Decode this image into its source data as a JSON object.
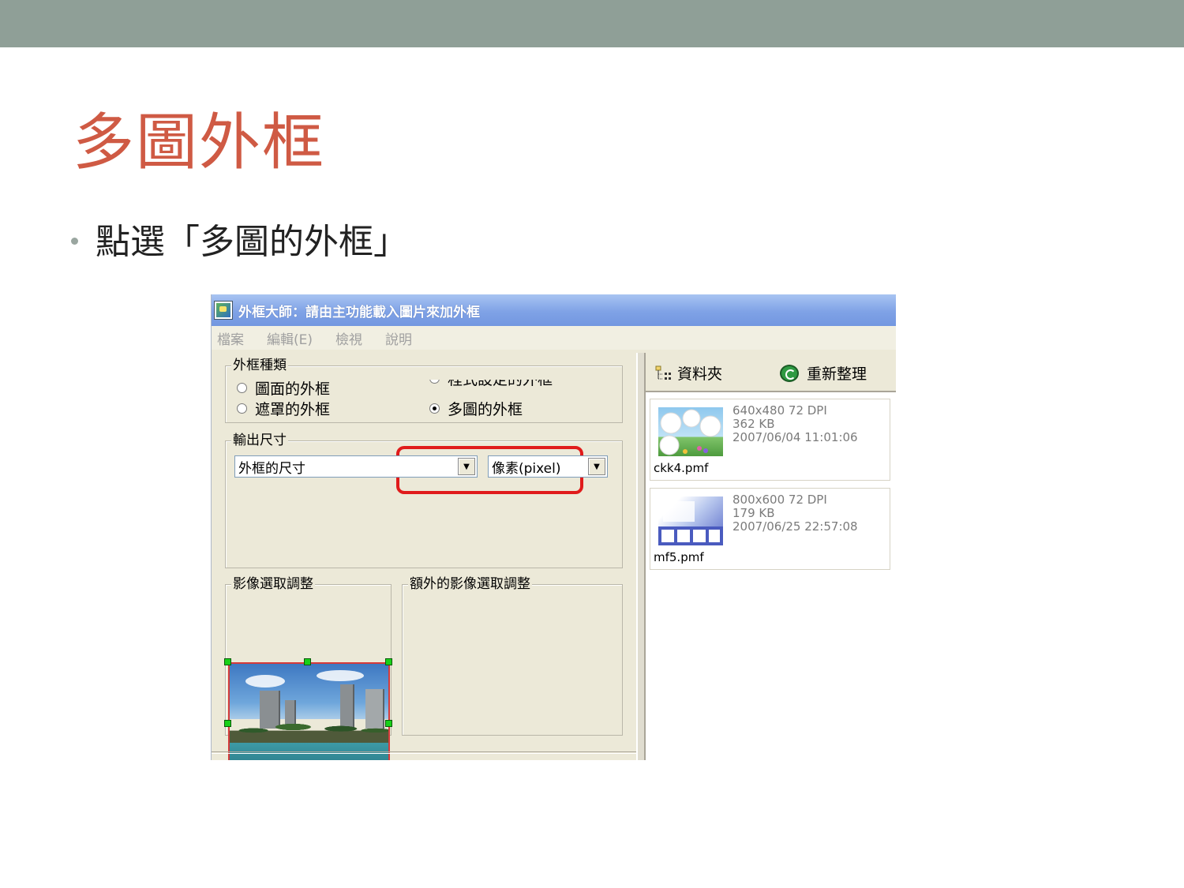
{
  "slide": {
    "title": "多圖外框",
    "bullet": "點選「多圖的外框」"
  },
  "window": {
    "title": "外框大師：請由主功能載入圖片來加外框",
    "menu": [
      "檔案",
      "編輯(E)",
      "檢視",
      "說明"
    ]
  },
  "frame_type": {
    "legend": "外框種類",
    "options": [
      {
        "label": "圖面的外框",
        "selected": false
      },
      {
        "label": "遮罩的外框",
        "selected": false
      },
      {
        "label": "程式設定的外框",
        "selected": false
      },
      {
        "label": "多圖的外框",
        "selected": true
      }
    ]
  },
  "output_size": {
    "legend": "輸出尺寸",
    "size_select": "外框的尺寸",
    "unit_select": "像素(pixel)"
  },
  "image_adjust": {
    "legend": "影像選取調整",
    "extra_legend": "額外的影像選取調整"
  },
  "right_panel": {
    "folder_label": "資料夾",
    "refresh_label": "重新整理",
    "files": [
      {
        "name": "ckk4.pmf",
        "dims": "640x480 72 DPI",
        "size": "362 KB",
        "date": "2007/06/04 11:01:06"
      },
      {
        "name": "mf5.pmf",
        "dims": "800x600 72 DPI",
        "size": "179 KB",
        "date": "2007/06/25 22:57:08"
      }
    ]
  },
  "colors": {
    "title_red": "#cf5a44",
    "band": "#8f9f97",
    "highlight": "#e01b1b",
    "xp_face": "#ece9d8"
  }
}
